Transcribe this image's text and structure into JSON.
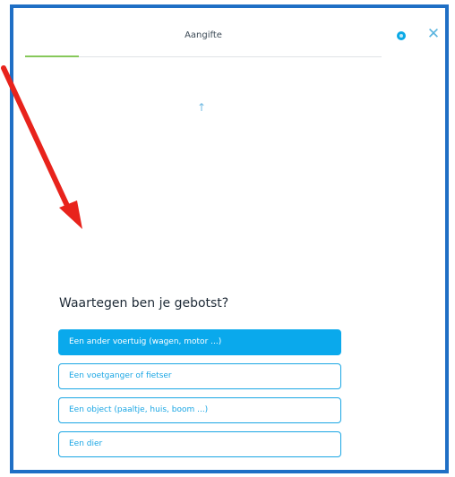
{
  "header": {
    "title": "Aangifte",
    "progress_fraction": 0.15,
    "chat_icon": "chat-icon",
    "close_icon": "close-icon",
    "close_glyph": "✕"
  },
  "main": {
    "up_icon_glyph": "↑",
    "question": "Waartegen ben je gebotst?",
    "options": [
      {
        "label": "Een ander voertuig (wagen, motor ...)",
        "selected": true
      },
      {
        "label": "Een voetganger of fietser",
        "selected": false
      },
      {
        "label": "Een object (paaltje, huis, boom ...)",
        "selected": false
      },
      {
        "label": "Een dier",
        "selected": false
      }
    ]
  },
  "colors": {
    "frame_border": "#1f6fc5",
    "accent": "#0aa9ec",
    "progress": "#86c85a",
    "annotation_arrow": "#e8231c"
  }
}
